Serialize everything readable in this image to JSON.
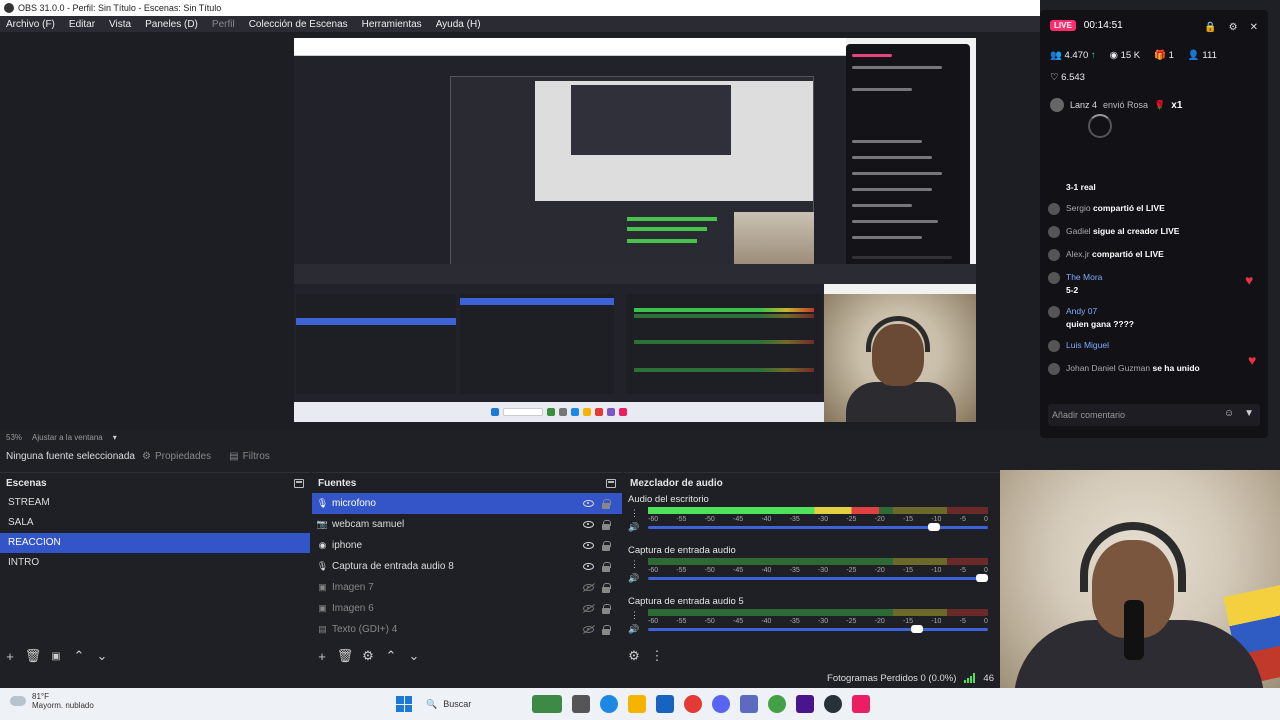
{
  "window": {
    "title": "OBS 31.0.0 - Perfil: Sin Título - Escenas: Sin Título"
  },
  "menu": [
    "Archivo (F)",
    "Editar",
    "Vista",
    "Paneles (D)",
    "Perfil",
    "Colección de Escenas",
    "Herramientas",
    "Ayuda (H)"
  ],
  "zoom": {
    "level": "53%",
    "fit_label": "Ajustar a la ventana"
  },
  "context": {
    "no_source": "Ninguna fuente seleccionada",
    "properties": "Propiedades",
    "filters": "Filtros"
  },
  "scenes": {
    "title": "Escenas",
    "items": [
      "STREAM",
      "SALA",
      "REACCION",
      "INTRO"
    ],
    "active": "REACCION"
  },
  "sources": {
    "title": "Fuentes",
    "items": [
      {
        "label": "microfono",
        "icon": "microphone-icon",
        "visible": true
      },
      {
        "label": "webcam samuel",
        "icon": "camera-icon",
        "visible": true
      },
      {
        "label": "iphone",
        "icon": "globe-icon",
        "visible": true
      },
      {
        "label": "Captura de entrada audio 8",
        "icon": "microphone-icon",
        "visible": true
      },
      {
        "label": "Imagen 7",
        "icon": "image-icon",
        "visible": false
      },
      {
        "label": "Imagen 6",
        "icon": "image-icon",
        "visible": false
      },
      {
        "label": "Texto (GDI+) 4",
        "icon": "text-icon",
        "visible": false
      }
    ]
  },
  "mixer": {
    "title": "Mezclador de audio",
    "scale": [
      "-60",
      "-55",
      "-50",
      "-45",
      "-40",
      "-35",
      "-30",
      "-25",
      "-20",
      "-15",
      "-10",
      "-5",
      "0"
    ],
    "tracks": [
      {
        "name": "Audio del escritorio",
        "level": 0.68,
        "volume": 0.86
      },
      {
        "name": "Captura de entrada audio",
        "level": 0.0,
        "volume": 1.0
      },
      {
        "name": "Captura de entrada audio 5",
        "level": 0.0,
        "volume": 0.81
      }
    ]
  },
  "status": {
    "dropped_frames": "Fotogramas Perdidos 0 (0.0%)",
    "trailing": "46"
  },
  "taskbar": {
    "weather_temp": "81°F",
    "weather_desc": "Mayorm. nublado",
    "search": "Buscar"
  },
  "live": {
    "badge": "LIVE",
    "timer": "00:14:51",
    "stats": {
      "viewers_change": "4.470",
      "views": "15 K",
      "gifts": "1",
      "users": "111"
    },
    "likes": "6.543",
    "gift": {
      "user": "Lanz 4",
      "action": "envió Rosa",
      "count": "x1"
    },
    "chat": [
      {
        "user": "",
        "text": "3-1 real",
        "style": "plain"
      },
      {
        "user": "Sergio",
        "text": "compartió el LIVE",
        "style": "share"
      },
      {
        "user": "Gadiel",
        "text": "sigue al creador LIVE",
        "style": "follow"
      },
      {
        "user": "Alex.jr",
        "text": "compartió el LIVE",
        "style": "share"
      },
      {
        "user": "The Mora",
        "text": "5-2",
        "style": "comment"
      },
      {
        "user": "Andy 07",
        "text": "quien gana ????",
        "style": "comment"
      },
      {
        "user": "Luis Miguel",
        "text": "",
        "style": "comment"
      },
      {
        "user": "Johan Daniel Guzman",
        "text": "se ha unido",
        "style": "join"
      }
    ],
    "comment_placeholder": "Añadir comentario"
  },
  "colors": {
    "accent": "#3355c8",
    "live": "#ff2d6f",
    "meter_green": "#4ee25a"
  }
}
